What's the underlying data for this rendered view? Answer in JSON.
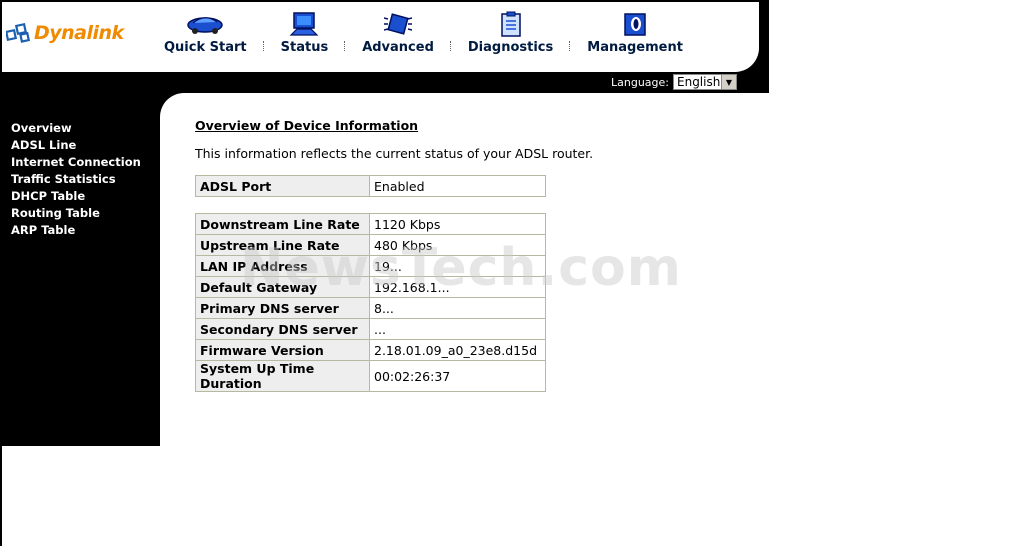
{
  "brand": {
    "name": "Dynalink"
  },
  "nav": [
    {
      "label": "Quick Start",
      "icon": "car-icon"
    },
    {
      "label": "Status",
      "icon": "monitor-icon"
    },
    {
      "label": "Advanced",
      "icon": "chip-icon"
    },
    {
      "label": "Diagnostics",
      "icon": "clipboard-icon"
    },
    {
      "label": "Management",
      "icon": "folder-icon"
    }
  ],
  "language": {
    "label": "Language:",
    "selected": "English"
  },
  "sidebar": {
    "items": [
      {
        "label": "Overview"
      },
      {
        "label": "ADSL Line"
      },
      {
        "label": "Internet Connection"
      },
      {
        "label": "Traffic Statistics"
      },
      {
        "label": "DHCP Table"
      },
      {
        "label": "Routing Table"
      },
      {
        "label": "ARP Table"
      }
    ]
  },
  "main": {
    "title": "Overview of Device Information",
    "description": "This information reflects the current status of your ADSL router.",
    "port_table": [
      {
        "key": "ADSL Port",
        "value": "Enabled"
      }
    ],
    "info_table": [
      {
        "key": "Downstream Line Rate",
        "value": "1120 Kbps"
      },
      {
        "key": "Upstream Line Rate",
        "value": "480 Kbps"
      },
      {
        "key": "LAN IP Address",
        "value": "19..."
      },
      {
        "key": "Default Gateway",
        "value": "192.168.1..."
      },
      {
        "key": "Primary DNS server",
        "value": "8..."
      },
      {
        "key": "Secondary DNS server",
        "value": "..."
      },
      {
        "key": "Firmware Version",
        "value": "2.18.01.09_a0_23e8.d15d"
      },
      {
        "key": "System Up Time Duration",
        "value": "00:02:26:37"
      }
    ]
  },
  "watermark": "NewsTech.com",
  "colors": {
    "accent": "#f08a00",
    "nav_text": "#001a40",
    "background": "#000000"
  }
}
